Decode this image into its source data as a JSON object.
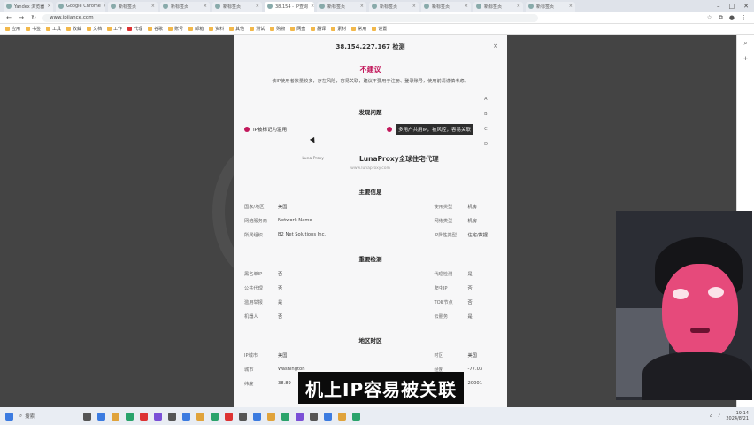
{
  "browser": {
    "tabs": [
      {
        "label": "Yandex 浏览器"
      },
      {
        "label": "Google Chrome"
      },
      {
        "label": "新标签页"
      },
      {
        "label": "新标签页"
      },
      {
        "label": "新标签页"
      },
      {
        "label": "38.154 - IP查询"
      },
      {
        "label": "新标签页"
      },
      {
        "label": "新标签页"
      },
      {
        "label": "新标签页"
      },
      {
        "label": "新标签页"
      },
      {
        "label": "新标签页"
      }
    ],
    "url": "www.ipjiance.com",
    "bookmarks": [
      {
        "label": "应用"
      },
      {
        "label": "书签"
      },
      {
        "label": "工具"
      },
      {
        "label": "收藏"
      },
      {
        "label": "文档"
      },
      {
        "label": "工作"
      },
      {
        "label": "代理"
      },
      {
        "label": "谷歌"
      },
      {
        "label": "账号"
      },
      {
        "label": "邮箱"
      },
      {
        "label": "资料"
      },
      {
        "label": "其他"
      },
      {
        "label": "测试"
      },
      {
        "label": "购物"
      },
      {
        "label": "网盘"
      },
      {
        "label": "翻译"
      },
      {
        "label": "素材"
      },
      {
        "label": "常用"
      },
      {
        "label": "设置"
      }
    ]
  },
  "report": {
    "ip_title": "38.154.227.167 检测",
    "verdict": "不建议",
    "verdict_desc": "该IP使用者数量较多，存在风险，容易关联，建议不要用于注册、登录账号，使用前请谨慎考虑。",
    "found_title": "发现问题",
    "issue_left": "IP被标记为滥用",
    "issue_right": "多用户共用IP，被风控，容易关联",
    "side_marks": [
      "A",
      "B",
      "C",
      "D"
    ],
    "brand_logo": "Luna Proxy",
    "brand_name": "LunaProxy全球住宅代理",
    "brand_sub": "www.lunaproxy.com",
    "main_info_title": "主要信息",
    "main_info": [
      {
        "k": "国家/地区",
        "v": "美国"
      },
      {
        "k": "使用类型",
        "v": "机房"
      },
      {
        "k": "网络服务商",
        "v": "Network Name"
      },
      {
        "k": "网络类型",
        "v": "机房"
      },
      {
        "k": "所属组织",
        "v": "B2 Net Solutions Inc."
      },
      {
        "k": "IP属性类型",
        "v": "住宅/数据"
      }
    ],
    "checks_title": "重要检测",
    "checks": [
      {
        "k": "黑名单IP",
        "v": "否"
      },
      {
        "k": "代理检测",
        "v": "是"
      },
      {
        "k": "公共代理",
        "v": "否"
      },
      {
        "k": "爬虫IP",
        "v": "否"
      },
      {
        "k": "滥用举报",
        "v": "是"
      },
      {
        "k": "TOR节点",
        "v": "否"
      },
      {
        "k": "机器人",
        "v": "否"
      },
      {
        "k": "云服务",
        "v": "是"
      }
    ],
    "region_title": "地区时区",
    "region": [
      {
        "k": "IP城市",
        "v": "美国"
      },
      {
        "k": "时区",
        "v": "美国"
      },
      {
        "k": "城市",
        "v": "Washington"
      },
      {
        "k": "经度",
        "v": "-77.03"
      },
      {
        "k": "纬度",
        "v": "38.89"
      },
      {
        "k": "邮编",
        "v": "20001"
      }
    ]
  },
  "subtitle": "机上IP容易被关联",
  "taskbar": {
    "search_label": "搜索",
    "time": "19:14",
    "date": "2024/8/21"
  },
  "colors": {
    "accent": "#c2185b"
  }
}
